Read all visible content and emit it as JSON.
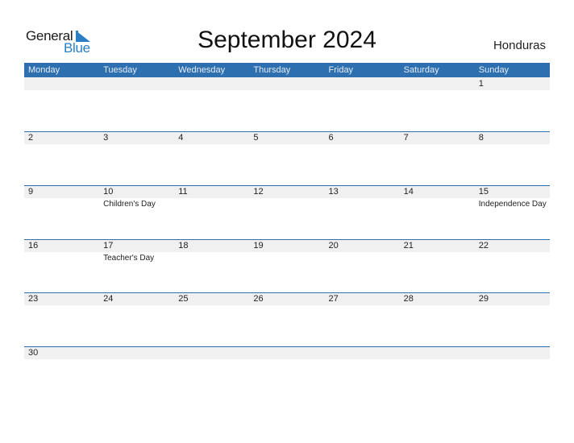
{
  "logo": {
    "line1": "General",
    "line2": "Blue"
  },
  "title": "September 2024",
  "country": "Honduras",
  "colors": {
    "header_bg": "#2e6fb0",
    "accent": "#2a7fc4",
    "strip": "#f0f0f0"
  },
  "weekdays": [
    "Monday",
    "Tuesday",
    "Wednesday",
    "Thursday",
    "Friday",
    "Saturday",
    "Sunday"
  ],
  "weeks": [
    {
      "days": [
        {
          "num": "",
          "holiday": ""
        },
        {
          "num": "",
          "holiday": ""
        },
        {
          "num": "",
          "holiday": ""
        },
        {
          "num": "",
          "holiday": ""
        },
        {
          "num": "",
          "holiday": ""
        },
        {
          "num": "",
          "holiday": ""
        },
        {
          "num": "1",
          "holiday": ""
        }
      ]
    },
    {
      "days": [
        {
          "num": "2",
          "holiday": ""
        },
        {
          "num": "3",
          "holiday": ""
        },
        {
          "num": "4",
          "holiday": ""
        },
        {
          "num": "5",
          "holiday": ""
        },
        {
          "num": "6",
          "holiday": ""
        },
        {
          "num": "7",
          "holiday": ""
        },
        {
          "num": "8",
          "holiday": ""
        }
      ]
    },
    {
      "days": [
        {
          "num": "9",
          "holiday": ""
        },
        {
          "num": "10",
          "holiday": "Children's Day"
        },
        {
          "num": "11",
          "holiday": ""
        },
        {
          "num": "12",
          "holiday": ""
        },
        {
          "num": "13",
          "holiday": ""
        },
        {
          "num": "14",
          "holiday": ""
        },
        {
          "num": "15",
          "holiday": "Independence Day"
        }
      ]
    },
    {
      "days": [
        {
          "num": "16",
          "holiday": ""
        },
        {
          "num": "17",
          "holiday": "Teacher's Day"
        },
        {
          "num": "18",
          "holiday": ""
        },
        {
          "num": "19",
          "holiday": ""
        },
        {
          "num": "20",
          "holiday": ""
        },
        {
          "num": "21",
          "holiday": ""
        },
        {
          "num": "22",
          "holiday": ""
        }
      ]
    },
    {
      "days": [
        {
          "num": "23",
          "holiday": ""
        },
        {
          "num": "24",
          "holiday": ""
        },
        {
          "num": "25",
          "holiday": ""
        },
        {
          "num": "26",
          "holiday": ""
        },
        {
          "num": "27",
          "holiday": ""
        },
        {
          "num": "28",
          "holiday": ""
        },
        {
          "num": "29",
          "holiday": ""
        }
      ]
    },
    {
      "days": [
        {
          "num": "30",
          "holiday": ""
        },
        {
          "num": "",
          "holiday": ""
        },
        {
          "num": "",
          "holiday": ""
        },
        {
          "num": "",
          "holiday": ""
        },
        {
          "num": "",
          "holiday": ""
        },
        {
          "num": "",
          "holiday": ""
        },
        {
          "num": "",
          "holiday": ""
        }
      ]
    }
  ]
}
